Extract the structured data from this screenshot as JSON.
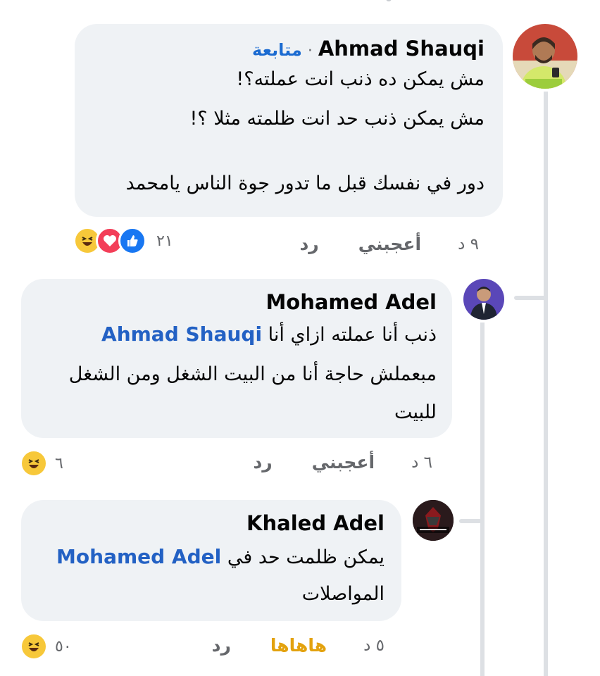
{
  "comments": [
    {
      "author": "Ahmad Shauqi",
      "follow_label": "متابعة",
      "separator": "·",
      "lines": [
        "مش يمكن ده ذنب انت عملته؟!",
        "مش يمكن ذنب حد انت ظلمته مثلا ؟!",
        "",
        "دور في نفسك قبل ما تدور جوة الناس يامحمد"
      ],
      "time": "٩ د",
      "like_label": "أعجبني",
      "reply_label": "رد",
      "reaction_count": "٢١",
      "reactions": [
        "like-icon",
        "love-icon",
        "haha-icon"
      ]
    },
    {
      "author": "Mohamed Adel",
      "mention": "Ahmad Shauqi",
      "line1_text": "ذنب أنا عملته ازاي أنا",
      "lines": [
        "مبعملش حاجة أنا من البيت الشغل ومن الشغل",
        "للبيت"
      ],
      "time": "٦ د",
      "like_label": "أعجبني",
      "reply_label": "رد",
      "reaction_count": "٦",
      "reactions": [
        "haha-icon"
      ]
    },
    {
      "author": "Khaled Adel",
      "mention": "Mohamed Adel",
      "line1_text": "يمكن ظلمت حد في",
      "lines": [
        "المواصلات"
      ],
      "time": "٥ د",
      "like_label": "هاهاها",
      "reply_label": "رد",
      "reaction_count": "٥٠",
      "reactions": [
        "haha-icon"
      ]
    }
  ],
  "colors": {
    "bubble": "#eff2f5",
    "mention": "#2361c4",
    "haha": "#e3a20e",
    "follow": "#1b6bd1",
    "like": "#1877f2",
    "love": "#f33e58"
  }
}
